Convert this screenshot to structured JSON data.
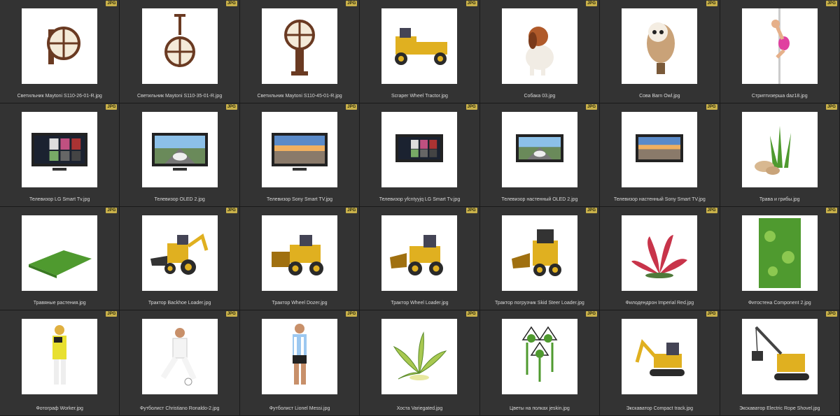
{
  "badge_label": "JPG",
  "items": [
    {
      "label": "Светильник Maytoni S110-26-01-R.jpg",
      "icon": "wall-lamp-icon"
    },
    {
      "label": "Светильник Maytoni S110-35-01-R.jpg",
      "icon": "hanging-lamp-icon"
    },
    {
      "label": "Светильник Maytoni S110-45-01-R.jpg",
      "icon": "post-lamp-icon"
    },
    {
      "label": "Scraper Wheel Tractor.jpg",
      "icon": "wheel-tractor-icon"
    },
    {
      "label": "Собака 03.jpg",
      "icon": "dog-icon"
    },
    {
      "label": "Сова Barn Owl.jpg",
      "icon": "owl-icon"
    },
    {
      "label": "Стриптизерша daz18.jpg",
      "icon": "pole-dancer-icon"
    },
    {
      "label": "Телевизор LG Smart Tv.jpg",
      "icon": "tv-apps-icon"
    },
    {
      "label": "Телевизор OLED 2.jpg",
      "icon": "tv-car-icon"
    },
    {
      "label": "Телевизор Sony Smart TV.jpg",
      "icon": "tv-city-icon"
    },
    {
      "label": "Телевизор yfcntyyjq LG Smart Tv.jpg",
      "icon": "tv-apps-wall-icon"
    },
    {
      "label": "Телевизор настенный OLED 2.jpg",
      "icon": "tv-car-wall-icon"
    },
    {
      "label": "Телевизор настенный Sony Smart TV.jpg",
      "icon": "tv-city-wall-icon"
    },
    {
      "label": "Трава и грибы.jpg",
      "icon": "grass-mushrooms-icon"
    },
    {
      "label": "Травяные растения.jpg",
      "icon": "grass-patch-icon"
    },
    {
      "label": "Трактор Backhoe Loader.jpg",
      "icon": "backhoe-loader-icon"
    },
    {
      "label": "Трактор Wheel Dozer.jpg",
      "icon": "wheel-dozer-icon"
    },
    {
      "label": "Трактор Wheel Loader.jpg",
      "icon": "wheel-loader-icon"
    },
    {
      "label": "Трактор погрузчик Skid Steer Loader.jpg",
      "icon": "skid-steer-icon"
    },
    {
      "label": "Филодендрон Imperial Red.jpg",
      "icon": "red-plant-icon"
    },
    {
      "label": "Фитостена Component 2.jpg",
      "icon": "green-wall-icon"
    },
    {
      "label": "Фотограф Worker.jpg",
      "icon": "photographer-icon"
    },
    {
      "label": "Футболист Christiano Ronaldo-2.jpg",
      "icon": "footballer-white-icon"
    },
    {
      "label": "Футболист Lionel Messi.jpg",
      "icon": "footballer-blue-icon"
    },
    {
      "label": "Хоста Variegated.jpg",
      "icon": "hosta-plant-icon"
    },
    {
      "label": "Цветы на полках jeskin.jpg",
      "icon": "hanging-flowers-icon"
    },
    {
      "label": "Экскаватор Compact track.jpg",
      "icon": "compact-excavator-icon"
    },
    {
      "label": "Экскаватор Electric Rope Shovel.jpg",
      "icon": "rope-shovel-icon"
    }
  ]
}
